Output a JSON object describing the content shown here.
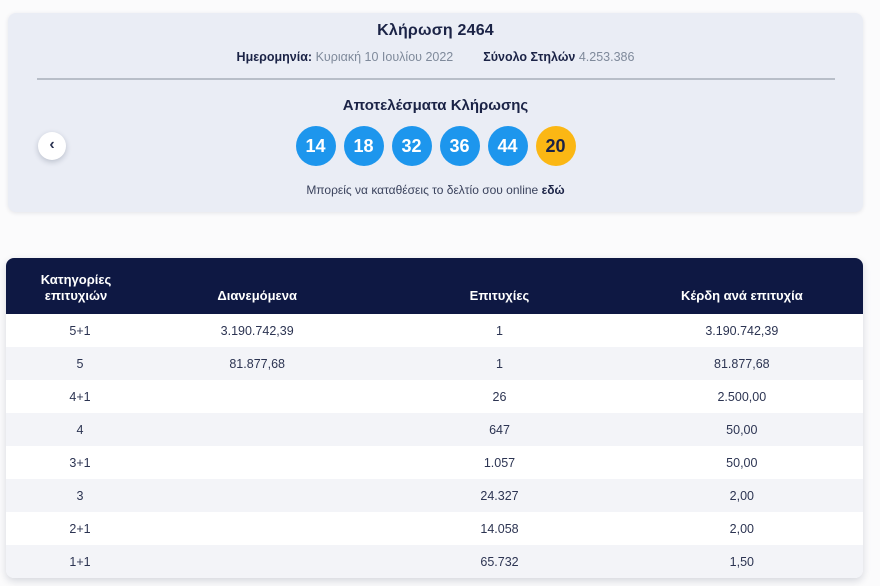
{
  "draw": {
    "title": "Κλήρωση 2464",
    "date_label": "Ημερομηνία:",
    "date_value": "Κυριακή 10 Ιουλίου 2022",
    "columns_label": "Σύνολο Στηλών",
    "columns_value": "4.253.386"
  },
  "nav": {
    "prev_icon": "‹"
  },
  "results": {
    "title": "Αποτελέσματα Κλήρωσης",
    "numbers": [
      {
        "value": "14",
        "type": "main"
      },
      {
        "value": "18",
        "type": "main"
      },
      {
        "value": "32",
        "type": "main"
      },
      {
        "value": "36",
        "type": "main"
      },
      {
        "value": "44",
        "type": "main"
      },
      {
        "value": "20",
        "type": "bonus"
      }
    ],
    "note_text": "Μπορείς να καταθέσεις το δελτίο σου online",
    "note_link": "εδώ"
  },
  "table": {
    "columns": [
      "Κατηγορίες επιτυχιών",
      "Διανεμόμενα",
      "Επιτυχίες",
      "Κέρδη ανά επιτυχία"
    ],
    "rows": [
      {
        "category": "5+1",
        "dividend": "3.190.742,39",
        "winners": "1",
        "prize": "3.190.742,39"
      },
      {
        "category": "5",
        "dividend": "81.877,68",
        "winners": "1",
        "prize": "81.877,68"
      },
      {
        "category": "4+1",
        "dividend": "",
        "winners": "26",
        "prize": "2.500,00"
      },
      {
        "category": "4",
        "dividend": "",
        "winners": "647",
        "prize": "50,00"
      },
      {
        "category": "3+1",
        "dividend": "",
        "winners": "1.057",
        "prize": "50,00"
      },
      {
        "category": "3",
        "dividend": "",
        "winners": "24.327",
        "prize": "2,00"
      },
      {
        "category": "2+1",
        "dividend": "",
        "winners": "14.058",
        "prize": "2,00"
      },
      {
        "category": "1+1",
        "dividend": "",
        "winners": "65.732",
        "prize": "1,50"
      }
    ]
  },
  "colors": {
    "main_ball": "#1d96ed",
    "bonus_ball": "#fbb714",
    "header_bg": "#0e1843",
    "card_bg": "#eaedf5"
  }
}
